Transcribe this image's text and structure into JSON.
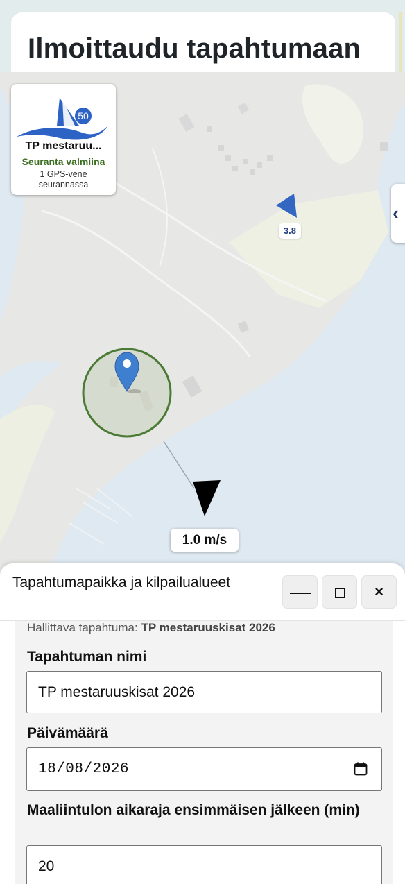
{
  "page": {
    "title": "Ilmoittaudu tapahtumaan"
  },
  "map": {
    "event_card": {
      "logo_badge": "50",
      "name": "TP mestaruu...",
      "status": "Seuranta valmiina",
      "tracking_line1": "1 GPS-vene",
      "tracking_line2": "seurannassa"
    },
    "side_toggle": "‹",
    "boat_speed_label": "3.8",
    "wind_label": "1.0 m/s",
    "colors": {
      "water": "#dfe9f1",
      "land": "#e6e6e6",
      "field": "#ecefe1",
      "circle": "#4a7a34",
      "marker": "#3f7fd0",
      "boat": "#3467c2"
    }
  },
  "panel": {
    "title": "Tapahtumapaikka ja kilpailualueet",
    "buttons": {
      "minimize": "minimize",
      "maximize": "maximize",
      "close": "×"
    },
    "managing_prefix": "Hallittava tapahtuma:",
    "managing_event": "TP mestaruuskisat 2026",
    "fields": {
      "name_label": "Tapahtuman nimi",
      "name_value": "TP mestaruuskisat 2026",
      "date_label": "Päivämäärä",
      "date_value": "18/08/2026",
      "finish_label": "Maaliintulon aikaraja ensimmäisen jälkeen (min)",
      "finish_value": "20"
    }
  }
}
